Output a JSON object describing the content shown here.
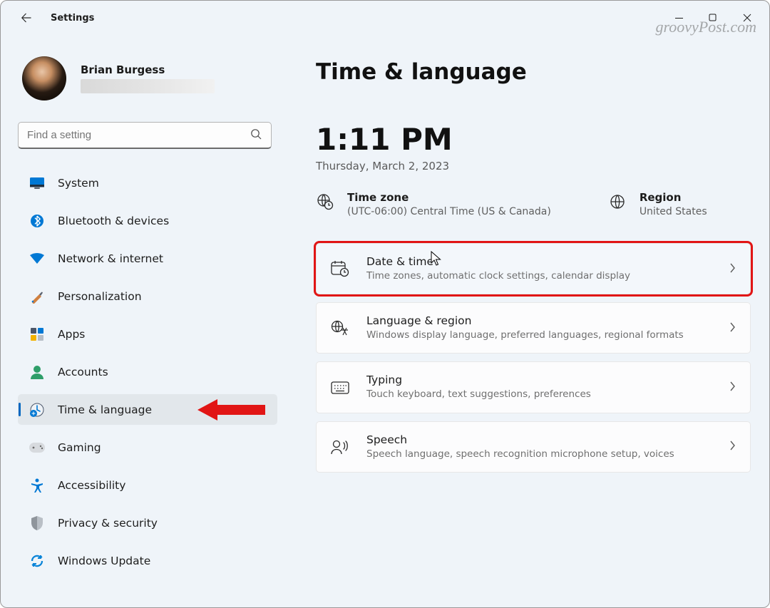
{
  "app": {
    "title": "Settings",
    "watermark": "groovyPost.com"
  },
  "user": {
    "name": "Brian Burgess"
  },
  "search": {
    "placeholder": "Find a setting"
  },
  "sidebar": {
    "items": [
      {
        "label": "System"
      },
      {
        "label": "Bluetooth & devices"
      },
      {
        "label": "Network & internet"
      },
      {
        "label": "Personalization"
      },
      {
        "label": "Apps"
      },
      {
        "label": "Accounts"
      },
      {
        "label": "Time & language"
      },
      {
        "label": "Gaming"
      },
      {
        "label": "Accessibility"
      },
      {
        "label": "Privacy & security"
      },
      {
        "label": "Windows Update"
      }
    ]
  },
  "page": {
    "title": "Time & language",
    "clock": {
      "time": "1:11 PM",
      "date": "Thursday, March 2, 2023"
    },
    "timezone": {
      "label": "Time zone",
      "value": "(UTC-06:00) Central Time (US & Canada)"
    },
    "region": {
      "label": "Region",
      "value": "United States"
    },
    "options": [
      {
        "title": "Date & time",
        "desc": "Time zones, automatic clock settings, calendar display"
      },
      {
        "title": "Language & region",
        "desc": "Windows display language, preferred languages, regional formats"
      },
      {
        "title": "Typing",
        "desc": "Touch keyboard, text suggestions, preferences"
      },
      {
        "title": "Speech",
        "desc": "Speech language, speech recognition microphone setup, voices"
      }
    ]
  }
}
